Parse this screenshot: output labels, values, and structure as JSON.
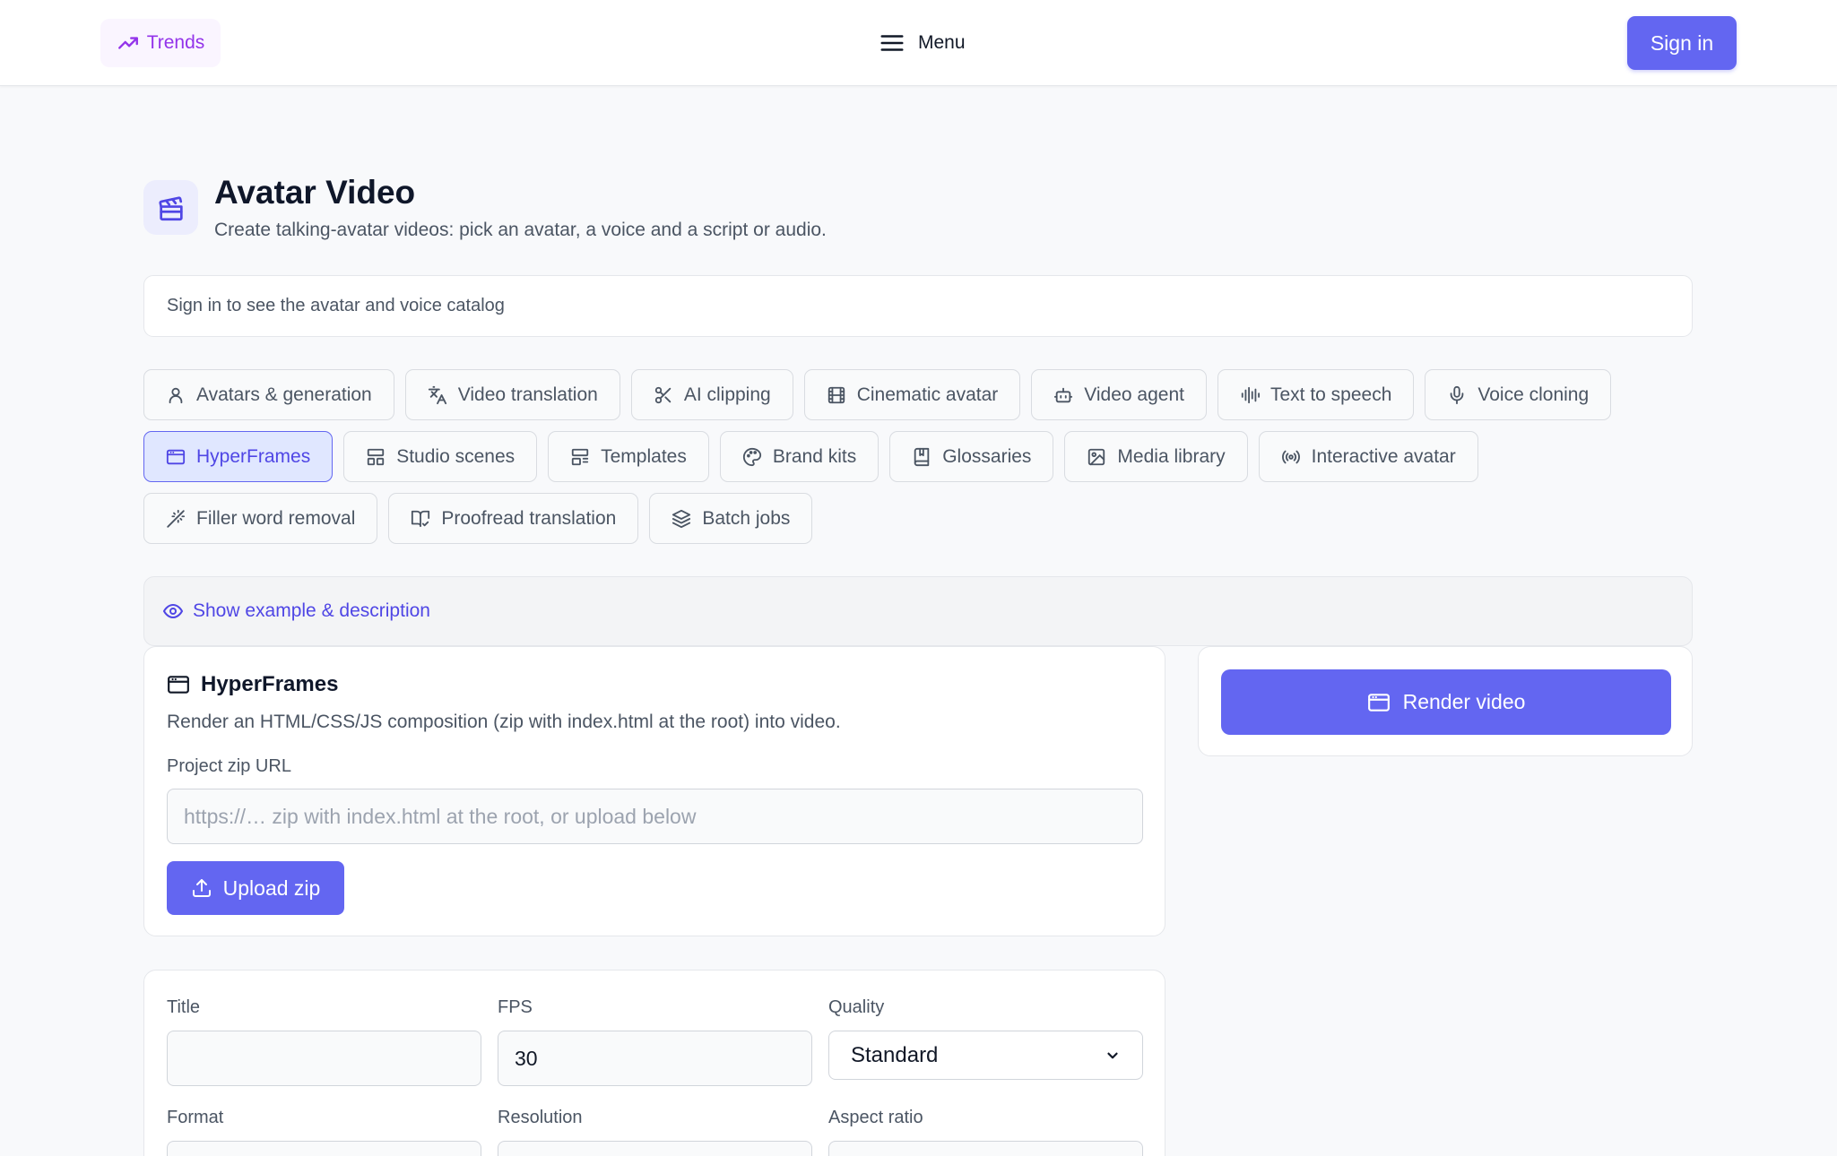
{
  "header": {
    "trends_label": "Trends",
    "menu_label": "Menu",
    "signin_label": "Sign in"
  },
  "page": {
    "title": "Avatar Video",
    "subtitle": "Create talking-avatar videos: pick an avatar, a voice and a script or audio.",
    "catalog_notice": "Sign in to see the avatar and voice catalog"
  },
  "tools": {
    "row1": [
      {
        "label": "Avatars & generation",
        "icon": "user-icon"
      },
      {
        "label": "Video translation",
        "icon": "translate-icon"
      },
      {
        "label": "AI clipping",
        "icon": "scissors-icon"
      },
      {
        "label": "Cinematic avatar",
        "icon": "film-icon"
      },
      {
        "label": "Video agent",
        "icon": "bot-icon"
      },
      {
        "label": "Text to speech",
        "icon": "audio-wave-icon"
      },
      {
        "label": "Voice cloning",
        "icon": "microphone-icon"
      }
    ],
    "row2": [
      {
        "label": "HyperFrames",
        "icon": "browser-window-icon",
        "active": true
      },
      {
        "label": "Studio scenes",
        "icon": "layout-icon"
      },
      {
        "label": "Templates",
        "icon": "template-icon"
      },
      {
        "label": "Brand kits",
        "icon": "palette-icon"
      },
      {
        "label": "Glossaries",
        "icon": "book-icon"
      },
      {
        "label": "Media library",
        "icon": "image-icon"
      },
      {
        "label": "Interactive avatar",
        "icon": "broadcast-icon"
      }
    ],
    "row3": [
      {
        "label": "Filler word removal",
        "icon": "magic-wand-icon"
      },
      {
        "label": "Proofread translation",
        "icon": "book-check-icon"
      },
      {
        "label": "Batch jobs",
        "icon": "layers-icon"
      }
    ]
  },
  "example": {
    "label": "Show example & description"
  },
  "hyperframes": {
    "title": "HyperFrames",
    "description": "Render an HTML/CSS/JS composition (zip with index.html at the root) into video.",
    "zip_label": "Project zip URL",
    "zip_placeholder": "https://… zip with index.html at the root, or upload below",
    "upload_label": "Upload zip"
  },
  "render": {
    "button_label": "Render video"
  },
  "settings": {
    "title_label": "Title",
    "title_value": "",
    "fps_label": "FPS",
    "fps_value": "30",
    "quality_label": "Quality",
    "quality_value": "Standard",
    "format_label": "Format",
    "resolution_label": "Resolution",
    "aspect_label": "Aspect ratio"
  },
  "colors": {
    "accent": "#6366f1",
    "trends": "#9333ea",
    "background": "#f8f9fb"
  }
}
